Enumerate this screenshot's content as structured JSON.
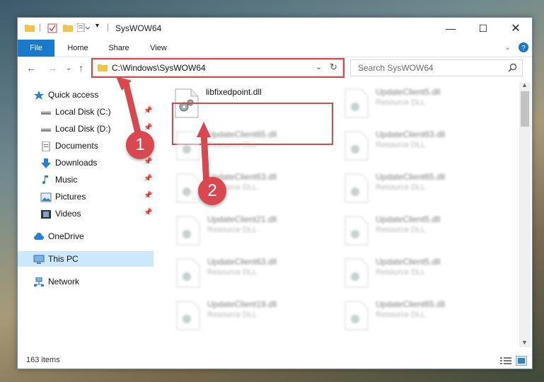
{
  "window": {
    "title": "SysWOW64"
  },
  "ribbon": {
    "tabs": [
      "File",
      "Home",
      "Share",
      "View"
    ]
  },
  "address": {
    "path": "C:\\Windows\\SysWOW64"
  },
  "search": {
    "placeholder": "Search SysWOW64"
  },
  "sidebar": {
    "items": [
      {
        "label": "Quick access",
        "icon": "star-icon"
      },
      {
        "label": "Local Disk (C:)",
        "icon": "drive-icon",
        "pinned": true
      },
      {
        "label": "Local Disk (D:)",
        "icon": "drive-icon",
        "pinned": true
      },
      {
        "label": "Documents",
        "icon": "documents-icon",
        "pinned": true
      },
      {
        "label": "Downloads",
        "icon": "download-icon",
        "pinned": true
      },
      {
        "label": "Music",
        "icon": "music-icon",
        "pinned": true
      },
      {
        "label": "Pictures",
        "icon": "pictures-icon",
        "pinned": true
      },
      {
        "label": "Videos",
        "icon": "videos-icon",
        "pinned": true
      },
      {
        "label": "OneDrive",
        "icon": "cloud-icon"
      },
      {
        "label": "This PC",
        "icon": "pc-icon",
        "selected": true
      },
      {
        "label": "Network",
        "icon": "network-icon"
      }
    ]
  },
  "files": {
    "highlighted": {
      "name": "libfixedpoint.dll"
    },
    "blurred": [
      {
        "name": "UpdateClient5.dll",
        "type": "Resource DLL"
      },
      {
        "name": "UpdateClient65.dll",
        "type": "Resource DLL"
      },
      {
        "name": "UpdateClient63.dll",
        "type": "Resource DLL"
      },
      {
        "name": "UpdateClient63.dll",
        "type": "Resource DLL"
      },
      {
        "name": "UpdateClient65.dll",
        "type": "Resource DLL"
      },
      {
        "name": "UpdateClient21.dll",
        "type": "Resource DLL"
      },
      {
        "name": "UpdateClient5.dll",
        "type": "Resource DLL"
      },
      {
        "name": "UpdateClient63.dll",
        "type": "Resource DLL"
      },
      {
        "name": "UpdateClient5.dll",
        "type": "Resource DLL"
      },
      {
        "name": "UpdateClient19.dll",
        "type": "Resource DLL"
      },
      {
        "name": "UpdateClient65.dll",
        "type": "Resource DLL"
      }
    ]
  },
  "status": {
    "count": "163 items"
  },
  "annotations": {
    "step1": "1",
    "step2": "2"
  },
  "colors": {
    "accent": "#1979ca",
    "highlight": "#d9484e",
    "selection": "#cce8ff"
  }
}
